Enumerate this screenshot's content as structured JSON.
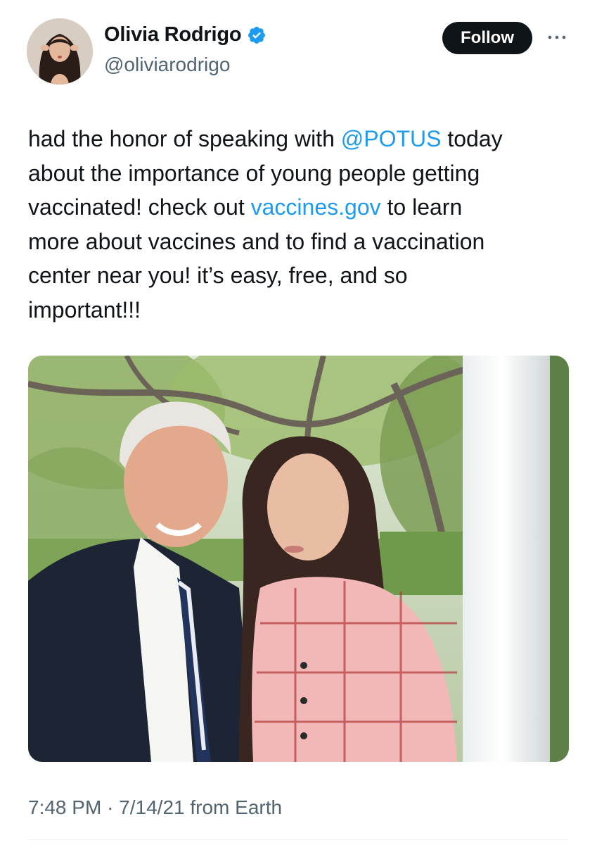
{
  "author": {
    "display_name": "Olivia Rodrigo",
    "handle": "@oliviarodrigo",
    "verified": true,
    "verified_icon": "verified-badge-icon"
  },
  "actions": {
    "follow_label": "Follow",
    "more_icon": "more-options-icon"
  },
  "tweet": {
    "lines": [
      [
        "had the honor of speaking with ",
        "@POTUS",
        " today"
      ],
      [
        "about the importance of young people getting"
      ],
      [
        "vaccinated! check out ",
        "vaccines.gov",
        " to learn"
      ],
      [
        "more about vaccines and to find a vaccination"
      ],
      [
        "center near you! it’s easy, free, and so"
      ],
      [
        "important!!!"
      ]
    ],
    "mention": "@POTUS",
    "link": "vaccines.gov"
  },
  "meta": {
    "time": "7:48 PM",
    "separator": "·",
    "date": "7/14/21",
    "source": "from Earth"
  },
  "colors": {
    "text": "#0f1419",
    "secondary": "#536471",
    "link": "#1d9bf0",
    "follow_bg": "#0f1419"
  }
}
